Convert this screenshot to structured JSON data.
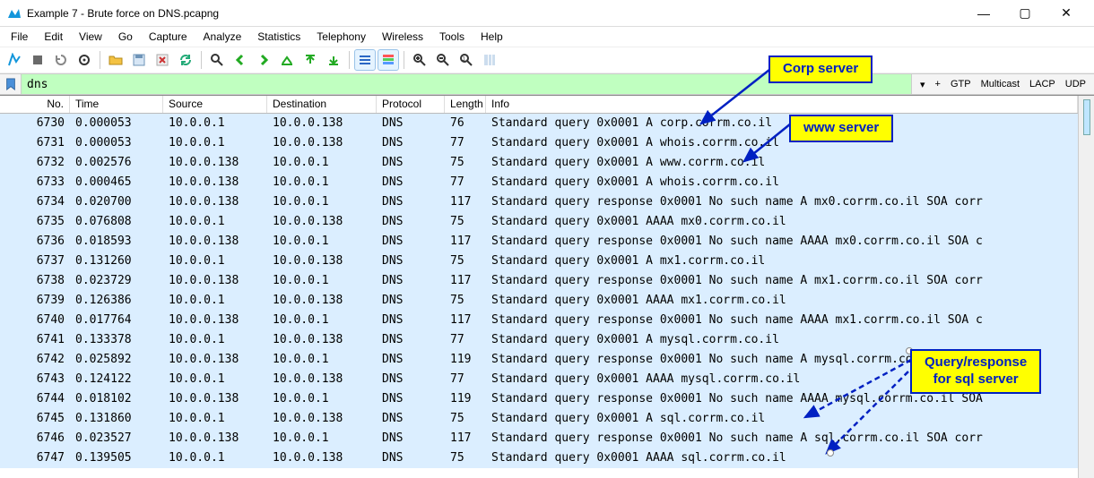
{
  "window": {
    "title": "Example 7 - Brute force on DNS.pcapng"
  },
  "menu": {
    "items": [
      "File",
      "Edit",
      "View",
      "Go",
      "Capture",
      "Analyze",
      "Statistics",
      "Telephony",
      "Wireless",
      "Tools",
      "Help"
    ]
  },
  "toolbar": {
    "icons": [
      "fin-icon",
      "stop-icon",
      "restart-icon",
      "options-icon",
      "open-icon",
      "save-icon",
      "close-icon",
      "reload-icon",
      "find-icon",
      "back-icon",
      "fwd-icon",
      "jump-icon",
      "first-icon",
      "last-icon",
      "autoscroll-icon",
      "colorize-icon",
      "zoom-in-icon",
      "zoom-out-icon",
      "zoom-reset-icon",
      "resize-cols-icon"
    ]
  },
  "filter": {
    "value": "dns",
    "buttons": [
      "▾",
      "+",
      "GTP",
      "Multicast",
      "LACP",
      "UDP"
    ]
  },
  "columns": [
    "No.",
    "Time",
    "Source",
    "Destination",
    "Protocol",
    "Length",
    "Info"
  ],
  "packets": [
    {
      "no": "6730",
      "time": "0.000053",
      "src": "10.0.0.1",
      "dst": "10.0.0.138",
      "proto": "DNS",
      "len": "76",
      "info": "Standard query 0x0001 A corp.corrm.co.il"
    },
    {
      "no": "6731",
      "time": "0.000053",
      "src": "10.0.0.1",
      "dst": "10.0.0.138",
      "proto": "DNS",
      "len": "77",
      "info": "Standard query 0x0001 A whois.corrm.co.il"
    },
    {
      "no": "6732",
      "time": "0.002576",
      "src": "10.0.0.138",
      "dst": "10.0.0.1",
      "proto": "DNS",
      "len": "75",
      "info": "Standard query 0x0001 A www.corrm.co.il"
    },
    {
      "no": "6733",
      "time": "0.000465",
      "src": "10.0.0.138",
      "dst": "10.0.0.1",
      "proto": "DNS",
      "len": "77",
      "info": "Standard query 0x0001 A whois.corrm.co.il"
    },
    {
      "no": "6734",
      "time": "0.020700",
      "src": "10.0.0.138",
      "dst": "10.0.0.1",
      "proto": "DNS",
      "len": "117",
      "info": "Standard query response 0x0001 No such name A mx0.corrm.co.il SOA corr"
    },
    {
      "no": "6735",
      "time": "0.076808",
      "src": "10.0.0.1",
      "dst": "10.0.0.138",
      "proto": "DNS",
      "len": "75",
      "info": "Standard query 0x0001 AAAA mx0.corrm.co.il"
    },
    {
      "no": "6736",
      "time": "0.018593",
      "src": "10.0.0.138",
      "dst": "10.0.0.1",
      "proto": "DNS",
      "len": "117",
      "info": "Standard query response 0x0001 No such name AAAA mx0.corrm.co.il SOA c"
    },
    {
      "no": "6737",
      "time": "0.131260",
      "src": "10.0.0.1",
      "dst": "10.0.0.138",
      "proto": "DNS",
      "len": "75",
      "info": "Standard query 0x0001 A mx1.corrm.co.il"
    },
    {
      "no": "6738",
      "time": "0.023729",
      "src": "10.0.0.138",
      "dst": "10.0.0.1",
      "proto": "DNS",
      "len": "117",
      "info": "Standard query response 0x0001 No such name A mx1.corrm.co.il SOA corr"
    },
    {
      "no": "6739",
      "time": "0.126386",
      "src": "10.0.0.1",
      "dst": "10.0.0.138",
      "proto": "DNS",
      "len": "75",
      "info": "Standard query 0x0001 AAAA mx1.corrm.co.il"
    },
    {
      "no": "6740",
      "time": "0.017764",
      "src": "10.0.0.138",
      "dst": "10.0.0.1",
      "proto": "DNS",
      "len": "117",
      "info": "Standard query response 0x0001 No such name AAAA mx1.corrm.co.il SOA c"
    },
    {
      "no": "6741",
      "time": "0.133378",
      "src": "10.0.0.1",
      "dst": "10.0.0.138",
      "proto": "DNS",
      "len": "77",
      "info": "Standard query 0x0001 A mysql.corrm.co.il"
    },
    {
      "no": "6742",
      "time": "0.025892",
      "src": "10.0.0.138",
      "dst": "10.0.0.1",
      "proto": "DNS",
      "len": "119",
      "info": "Standard query response 0x0001 No such name A mysql.corrm.co.il SOA co"
    },
    {
      "no": "6743",
      "time": "0.124122",
      "src": "10.0.0.1",
      "dst": "10.0.0.138",
      "proto": "DNS",
      "len": "77",
      "info": "Standard query 0x0001 AAAA mysql.corrm.co.il"
    },
    {
      "no": "6744",
      "time": "0.018102",
      "src": "10.0.0.138",
      "dst": "10.0.0.1",
      "proto": "DNS",
      "len": "119",
      "info": "Standard query response 0x0001 No such name AAAA mysql.corrm.co.il SOA"
    },
    {
      "no": "6745",
      "time": "0.131860",
      "src": "10.0.0.1",
      "dst": "10.0.0.138",
      "proto": "DNS",
      "len": "75",
      "info": "Standard query 0x0001 A sql.corrm.co.il"
    },
    {
      "no": "6746",
      "time": "0.023527",
      "src": "10.0.0.138",
      "dst": "10.0.0.1",
      "proto": "DNS",
      "len": "117",
      "info": "Standard query response 0x0001 No such name A sql.corrm.co.il SOA corr"
    },
    {
      "no": "6747",
      "time": "0.139505",
      "src": "10.0.0.1",
      "dst": "10.0.0.138",
      "proto": "DNS",
      "len": "75",
      "info": "Standard query 0x0001 AAAA sql.corrm.co.il"
    }
  ],
  "callouts": {
    "corp": "Corp server",
    "www": "www server",
    "sql_line1": "Query/response",
    "sql_line2": "for sql server"
  }
}
